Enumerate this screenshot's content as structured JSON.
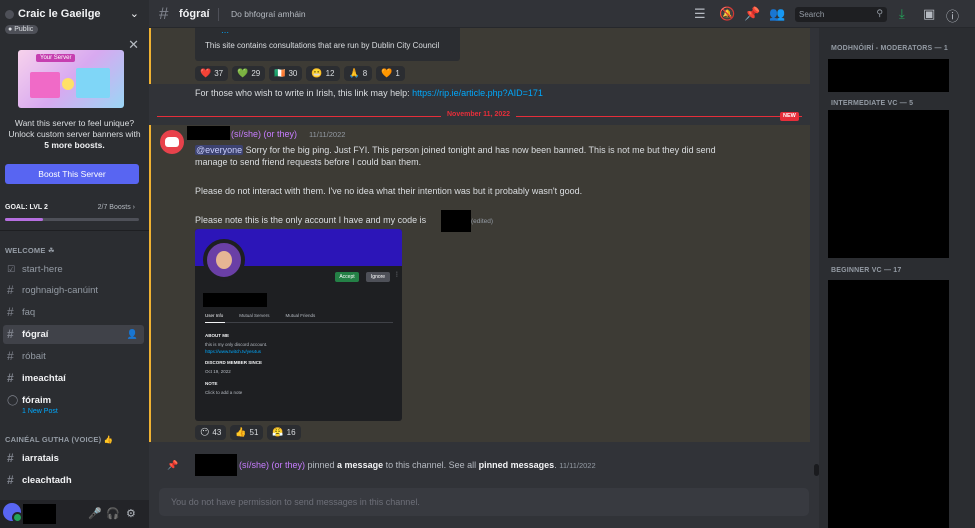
{
  "server": {
    "name": "Craic le Gaeilge",
    "public_label": "Public",
    "promo": {
      "banner_tag": "Your Server",
      "text_line1": "Want this server to feel unique?",
      "text_line2": "Unlock custom server banners with",
      "text_bold": "5 more boosts.",
      "button": "Boost This Server"
    },
    "goal": {
      "label": "GOAL: LVL 2",
      "boosts": "2/7 Boosts",
      "progress": 0.28
    },
    "categories": [
      {
        "name": "WELCOME ☘",
        "channels": [
          {
            "name": "start-here",
            "icon": "rules-icon"
          },
          {
            "name": "roghnaigh-canúint",
            "icon": "hash-icon"
          },
          {
            "name": "faq",
            "icon": "hash-icon"
          },
          {
            "name": "fógraí",
            "icon": "hash-icon"
          },
          {
            "name": "róbait",
            "icon": "hash-icon"
          },
          {
            "name": "imeachtaí",
            "icon": "hash-icon"
          },
          {
            "name": "fóraim",
            "icon": "forum-icon",
            "sub": "1 New Post"
          }
        ]
      },
      {
        "name": "CAINÉAL GUTHA (VOICE) 👍",
        "channels": [
          {
            "name": "iarratais",
            "icon": "hash-icon"
          },
          {
            "name": "cleachtadh",
            "icon": "hash-icon"
          }
        ]
      }
    ]
  },
  "header": {
    "channel": "fógraí",
    "topic": "Do bhfograí amháin",
    "search_placeholder": "Search"
  },
  "chat": {
    "embed_text": "This site contains consultations that are run by Dublin City Council",
    "reactions_top": [
      {
        "emoji": "❤️",
        "count": "37"
      },
      {
        "emoji": "💚",
        "count": "29"
      },
      {
        "emoji": "🇮🇪",
        "count": "30"
      },
      {
        "emoji": "😬",
        "count": "12"
      },
      {
        "emoji": "🙏",
        "count": "8"
      },
      {
        "emoji": "🧡",
        "count": "1"
      }
    ],
    "irish_line": "For those who wish to write in Irish, this link may help: ",
    "irish_link": "https://rip.ie/article.php?AID=171",
    "date_divider": "November 11, 2022",
    "new_flag": "NEW",
    "message": {
      "pronouns": "(sí/she) (or they)",
      "timestamp": "11/11/2022",
      "mention": "@everyone",
      "line1": " Sorry for the big ping. Just FYI. This person joined tonight and has now been banned. This is not me but they did send",
      "line2": "manage to send friend requests before I could ban them.",
      "para2": "Please do not interact with them. I've no idea what their intention was but it probably wasn't good.",
      "para3": "Please note this is the only account I have and my code is",
      "edited": "(edited)"
    },
    "screenshot": {
      "accept": "Accept",
      "ignore": "Ignore",
      "tabs": [
        "User Info",
        "Mutual Servers",
        "Mutual Friends"
      ],
      "about_head": "ABOUT ME",
      "about_text": "this is my only discord account.",
      "about_link": "https://www.twitch.tv/yes4us",
      "since_head": "DISCORD MEMBER SINCE",
      "since_val": "Oct 19, 2022",
      "note_head": "NOTE",
      "note_val": "Click to add a note"
    },
    "reactions_bottom": [
      {
        "emoji": "😶",
        "count": "43"
      },
      {
        "emoji": "👍",
        "count": "51"
      },
      {
        "emoji": "😤",
        "count": "16"
      }
    ],
    "pin": {
      "pronouns": "(sí/she) (or they)",
      "text1": " pinned ",
      "bold1": "a message",
      "text2": " to this channel. See all ",
      "bold2": "pinned messages",
      "text3": ".",
      "timestamp": "11/11/2022"
    },
    "composer_placeholder": "You do not have permission to send messages in this channel."
  },
  "members": {
    "groups": [
      {
        "label": "MODHNÓIRÍ - MODERATORS — 1"
      },
      {
        "label": "INTERMEDIATE VC — 5"
      },
      {
        "label": "BEGINNER VC — 17"
      }
    ]
  },
  "colors": {
    "accent": "#5865f2",
    "highlight_bar": "#f0b232",
    "new_divider": "#e62e3a",
    "link": "#00a8fc",
    "pronoun": "#c77dff"
  }
}
